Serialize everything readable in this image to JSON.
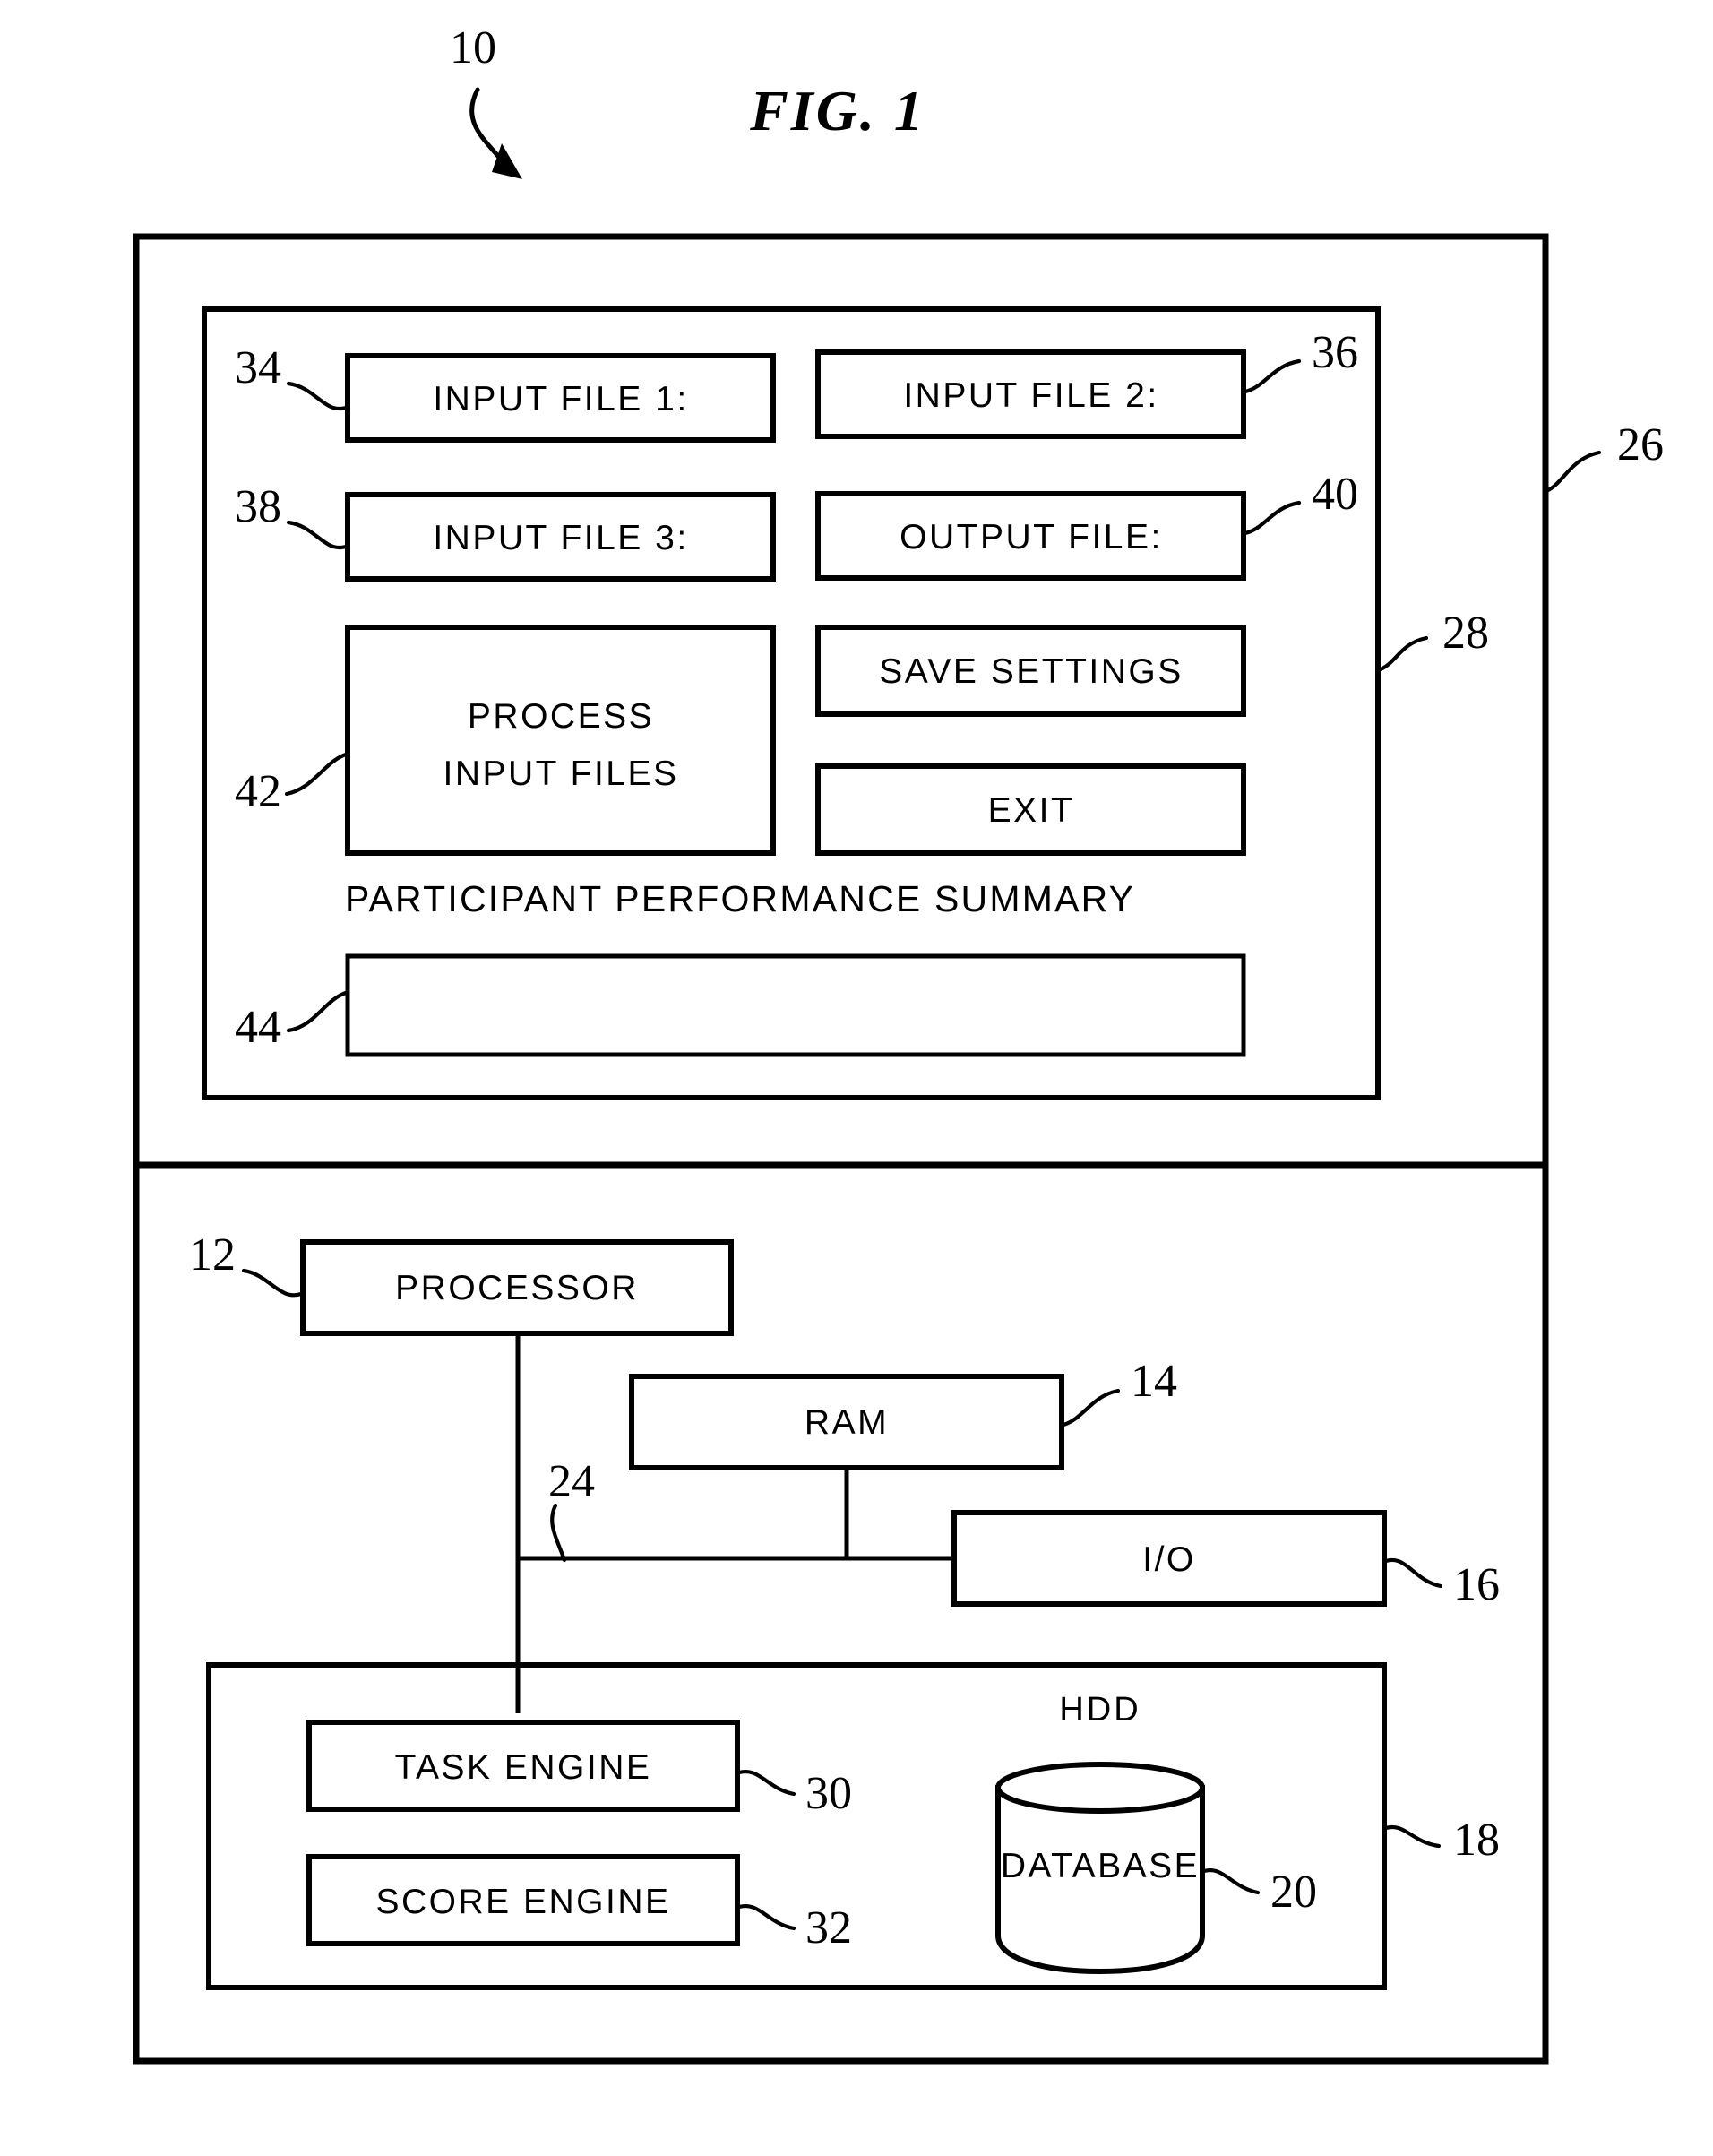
{
  "figure": {
    "title": "FIG.  1",
    "system_ref": "10"
  },
  "ui_panel": {
    "outer_ref": "26",
    "panel_ref": "28",
    "buttons": [
      {
        "label": "INPUT FILE 1:",
        "ref": "34"
      },
      {
        "label": "INPUT FILE 2:",
        "ref": "36"
      },
      {
        "label": "INPUT FILE 3:",
        "ref": "38"
      },
      {
        "label": "OUTPUT FILE:",
        "ref": "40"
      },
      {
        "label": "SAVE SETTINGS",
        "ref": ""
      },
      {
        "label": "EXIT",
        "ref": ""
      }
    ],
    "process_button": {
      "line1": "PROCESS",
      "line2": "INPUT FILES",
      "ref": "42"
    },
    "summary": {
      "title": "PARTICIPANT PERFORMANCE SUMMARY",
      "field_value": "",
      "ref": "44"
    }
  },
  "hardware_panel": {
    "processor": {
      "label": "PROCESSOR",
      "ref": "12"
    },
    "ram": {
      "label": "RAM",
      "ref": "14"
    },
    "io": {
      "label": "I/O",
      "ref": "16"
    },
    "bus": {
      "ref": "24"
    },
    "storage": {
      "ref": "18",
      "task_engine": {
        "label": "TASK ENGINE",
        "ref": "30"
      },
      "score_engine": {
        "label": "SCORE ENGINE",
        "ref": "32"
      },
      "hdd_label": "HDD",
      "database": {
        "label": "DATABASE",
        "ref": "20"
      }
    }
  },
  "colors": {
    "ink": "#000000",
    "paper": "#ffffff"
  }
}
